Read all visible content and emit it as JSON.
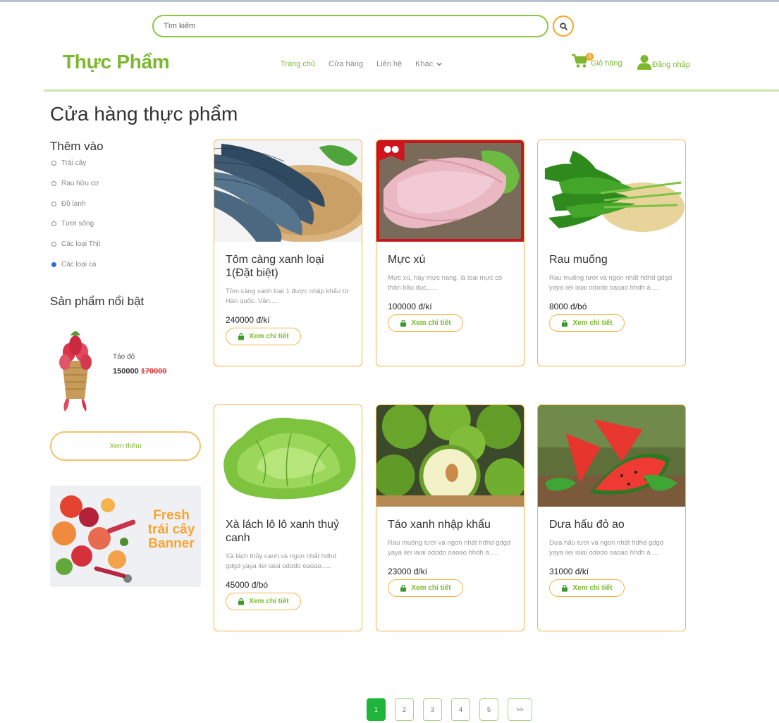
{
  "search": {
    "placeholder": "Tìm kiếm"
  },
  "header": {
    "logo": "Thực Phẩm",
    "nav": [
      {
        "label": "Trang chủ",
        "active": true
      },
      {
        "label": "Cửa hàng"
      },
      {
        "label": "Liên hệ"
      },
      {
        "label": "Khác"
      }
    ],
    "cart_label": "Giỏ hàng",
    "cart_count": "0",
    "login_label": "Đăng nhập"
  },
  "page_title": "Cửa hàng thực phẩm",
  "sidebar": {
    "filter_title": "Thêm vào",
    "filters": [
      {
        "label": "Trái cây",
        "checked": false
      },
      {
        "label": "Rau hữu cơ",
        "checked": false
      },
      {
        "label": "Đồ lạnh",
        "checked": false
      },
      {
        "label": "Tươi sống",
        "checked": false
      },
      {
        "label": "Các loại Thịt",
        "checked": false
      },
      {
        "label": "Các loại cá",
        "checked": true
      }
    ],
    "featured_title": "Sản phẩm nổi bật",
    "featured": {
      "name": "Táo đỏ",
      "price": "150000",
      "old_price": "170000"
    },
    "more_label": "Xem thêm",
    "banner": {
      "line1": "Fresh",
      "line2": "trái cây",
      "line3": "Banner"
    }
  },
  "products": [
    {
      "name": "Tôm càng xanh loại 1(Đặt biệt)",
      "desc": "Tôm càng xanh loại 1 được nhập khẩu từ Hàn quốc. Vân.....",
      "price": "240000 đ/kí"
    },
    {
      "name": "Mực xú",
      "desc": "Mực xú, hay mực nang, là loại mực có thân bầu dục,.....",
      "price": "100000 đ/kí"
    },
    {
      "name": "Rau muống",
      "desc": "Rau muống tươi và ngon nhất hdhd gdgd yaya iiei iaiai ododo oaoao hhdh à.....",
      "price": "8000 đ/bó"
    },
    {
      "name": "Xà lách lô lô xanh thuỷ canh",
      "desc": "Xà lách thủy canh và ngon nhất hdhd gdgd yaya iiei iaiai ododo oaoao.....",
      "price": "45000 đ/bó"
    },
    {
      "name": "Táo xanh nhập khẩu",
      "desc": "Rau muống tươi và ngon nhất hdhd gdgd yaya iiei iaiai ododo oaoao hhdh à.....",
      "price": "23000 đ/kí"
    },
    {
      "name": "Dưa hấu đỏ ao",
      "desc": "Dưa hấu tươi và ngon nhất hdhd gdgd yaya iiei iaiai ododo oaoao hhdh à.....",
      "price": "31000 đ/kí"
    }
  ],
  "detail_label": "Xem chi tiết",
  "pagination": [
    "1",
    "2",
    "3",
    "4",
    "5",
    ">>"
  ],
  "colors": {
    "brand_green": "#7cb82f",
    "accent_orange": "#f5a623",
    "active_page": "#1fb53a"
  }
}
